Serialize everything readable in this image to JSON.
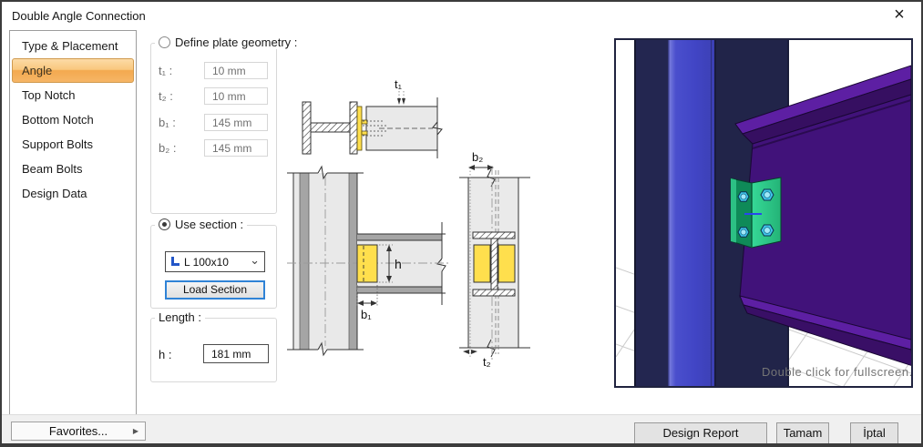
{
  "window": {
    "title": "Double Angle Connection"
  },
  "icons": {
    "close": "×",
    "dropdown_chevron": "⌄",
    "favorites_arrow": "▶"
  },
  "sidebar": {
    "items": [
      {
        "label": "Type & Placement",
        "selected": false
      },
      {
        "label": "Angle",
        "selected": true
      },
      {
        "label": "Top Notch",
        "selected": false
      },
      {
        "label": "Bottom Notch",
        "selected": false
      },
      {
        "label": "Support Bolts",
        "selected": false
      },
      {
        "label": "Beam Bolts",
        "selected": false
      },
      {
        "label": "Design Data",
        "selected": false
      }
    ]
  },
  "plate_geometry": {
    "radio_label": "Define plate geometry :",
    "radio_checked": false,
    "fields": [
      {
        "label": "t₁ :",
        "value": "10 mm"
      },
      {
        "label": "t₂ :",
        "value": "10 mm"
      },
      {
        "label": "b₁ :",
        "value": "145 mm"
      },
      {
        "label": "b₂ :",
        "value": "145 mm"
      }
    ]
  },
  "use_section": {
    "radio_label": "Use section :",
    "radio_checked": true,
    "section_value": "L 100x10",
    "load_button": "Load Section"
  },
  "length": {
    "group_label": "Length :",
    "field_label": "h :",
    "value": "181 mm"
  },
  "diagram_labels": {
    "t1": "t₁",
    "t2": "t₂",
    "b1": "b₁",
    "b2": "b₂",
    "h": "h"
  },
  "viewport": {
    "hint": "Double click for fullscreen."
  },
  "footer": {
    "favorites": "Favorites...",
    "design_report": "Design Report",
    "ok": "Tamam",
    "cancel": "İptal"
  },
  "colors": {
    "selection_orange": "#f5a94f",
    "plate_yellow": "#ffdf4d",
    "column_blue": "#4145c5",
    "column_navy": "#212449",
    "beam_purple": "#41127a",
    "angle_green": "#2fca8c",
    "bolt_cyan": "#3fc4e8",
    "load_button_border": "#3083d6"
  }
}
